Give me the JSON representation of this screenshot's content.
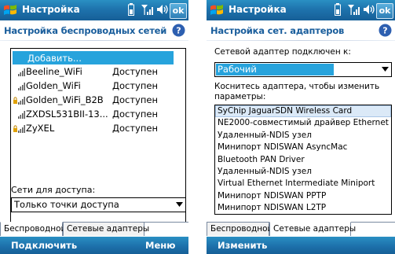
{
  "left_screen": {
    "title": "Настройка",
    "ok_label": "ok",
    "heading": "Настройка беспроводных сетей",
    "list": {
      "add_label": "Добавить...",
      "networks": [
        {
          "name": "Beeline_WiFi",
          "status": "Доступен",
          "icon": "signal-icon",
          "locked": false
        },
        {
          "name": "Golden_WiFi",
          "status": "Доступен",
          "icon": "signal-icon",
          "locked": false
        },
        {
          "name": "Golden_WiFi_B2B",
          "status": "Доступен",
          "icon": "secure-signal-icon",
          "locked": true
        },
        {
          "name": "ZXDSL531BII-13...",
          "status": "Доступен",
          "icon": "signal-icon",
          "locked": false
        },
        {
          "name": "ZyXEL",
          "status": "Доступен",
          "icon": "secure-signal-icon",
          "locked": true
        }
      ]
    },
    "access_label": "Сети для доступа:",
    "access_value": "Только точки доступа",
    "tabs": [
      {
        "label": "Беспроводной",
        "active": true
      },
      {
        "label": "Сетевые адаптеры",
        "active": false
      }
    ],
    "softkeys": {
      "left": "Подключить",
      "right": "Меню"
    }
  },
  "right_screen": {
    "title": "Настройка",
    "ok_label": "ok",
    "heading": "Настройка сет. адаптеров",
    "connected_label": "Сетевой адаптер подключен к:",
    "connected_value": "Рабочий",
    "tap_label_1": "Коснитесь адаптера, чтобы изменить",
    "tap_label_2": "параметры:",
    "adapters": [
      {
        "name": "SyChip JaguarSDN Wireless Card",
        "selected": true
      },
      {
        "name": "NE2000-совместимый драйвер Ethernet",
        "selected": false
      },
      {
        "name": "Удаленный-NDIS узел",
        "selected": false
      },
      {
        "name": "Минипорт NDISWAN AsyncMac",
        "selected": false
      },
      {
        "name": "Bluetooth PAN Driver",
        "selected": false
      },
      {
        "name": "Удаленный-NDIS узел",
        "selected": false
      },
      {
        "name": "Virtual Ethernet Intermediate Miniport",
        "selected": false
      },
      {
        "name": "Минипорт NDISWAN PPTP",
        "selected": false
      },
      {
        "name": "Минипорт NDISWAN L2TP",
        "selected": false
      }
    ],
    "tabs": [
      {
        "label": "Беспроводной",
        "active": false
      },
      {
        "label": "Сетевые адаптеры",
        "active": true
      }
    ],
    "softkeys": {
      "left": "Изменить",
      "right": ""
    }
  },
  "colors": {
    "titlebar": "#1e73ad",
    "heading": "#1a5e9c",
    "selection": "#27a3dc",
    "adapter_selected": "#dbe9f7"
  },
  "icons": [
    "windows-start-icon",
    "battery-icon",
    "signal-strength-icon",
    "speaker-icon",
    "help-icon",
    "dropdown-arrow-icon",
    "signal-icon",
    "secure-signal-icon"
  ]
}
